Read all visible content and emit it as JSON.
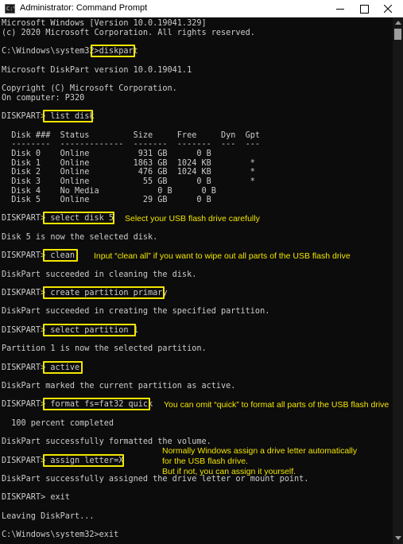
{
  "window": {
    "title": "Administrator: Command Prompt",
    "icon_text": "C:\\",
    "controls": [
      "minimize-icon",
      "maximize-icon",
      "close-icon"
    ]
  },
  "console": {
    "lines": [
      "Microsoft Windows [Version 10.0.19041.329]",
      "(c) 2020 Microsoft Corporation. All rights reserved.",
      "",
      "C:\\Windows\\system32>diskpart",
      "",
      "Microsoft DiskPart version 10.0.19041.1",
      "",
      "Copyright (C) Microsoft Corporation.",
      "On computer: P320",
      "",
      "DISKPART> list disk",
      "",
      "  Disk ###  Status         Size     Free     Dyn  Gpt",
      "  --------  -------------  -------  -------  ---  ---",
      "  Disk 0    Online          931 GB      0 B",
      "  Disk 1    Online         1863 GB  1024 KB        *",
      "  Disk 2    Online          476 GB  1024 KB        *",
      "  Disk 3    Online           55 GB      0 B        *",
      "  Disk 4    No Media            0 B      0 B",
      "  Disk 5    Online           29 GB      0 B",
      "",
      "DISKPART> select disk 5",
      "",
      "Disk 5 is now the selected disk.",
      "",
      "DISKPART> clean",
      "",
      "DiskPart succeeded in cleaning the disk.",
      "",
      "DISKPART> create partition primary",
      "",
      "DiskPart succeeded in creating the specified partition.",
      "",
      "DISKPART> select partition 1",
      "",
      "Partition 1 is now the selected partition.",
      "",
      "DISKPART> active",
      "",
      "DiskPart marked the current partition as active.",
      "",
      "DISKPART> format fs=fat32 quick",
      "",
      "  100 percent completed",
      "",
      "DiskPart successfully formatted the volume.",
      "",
      "DISKPART> assign letter=X",
      "",
      "DiskPart successfully assigned the drive letter or mount point.",
      "",
      "DISKPART> exit",
      "",
      "Leaving DiskPart...",
      "",
      "C:\\Windows\\system32>exit"
    ]
  },
  "annotations": {
    "select_disk": "Select your USB flash drive carefully",
    "clean": "Input “clean all” if you want to wipe out all parts of the USB flash drive",
    "format": "You can omit “quick” to format all parts of the USB flash drive",
    "assign_1": "Normally Windows assign a drive letter automatically",
    "assign_2": "for the USB flash drive.",
    "assign_3": "But if not, you can assign it yourself."
  },
  "colors": {
    "console_bg": "#0c0c0c",
    "console_text": "#cccccc",
    "highlight": "#f2e500"
  }
}
